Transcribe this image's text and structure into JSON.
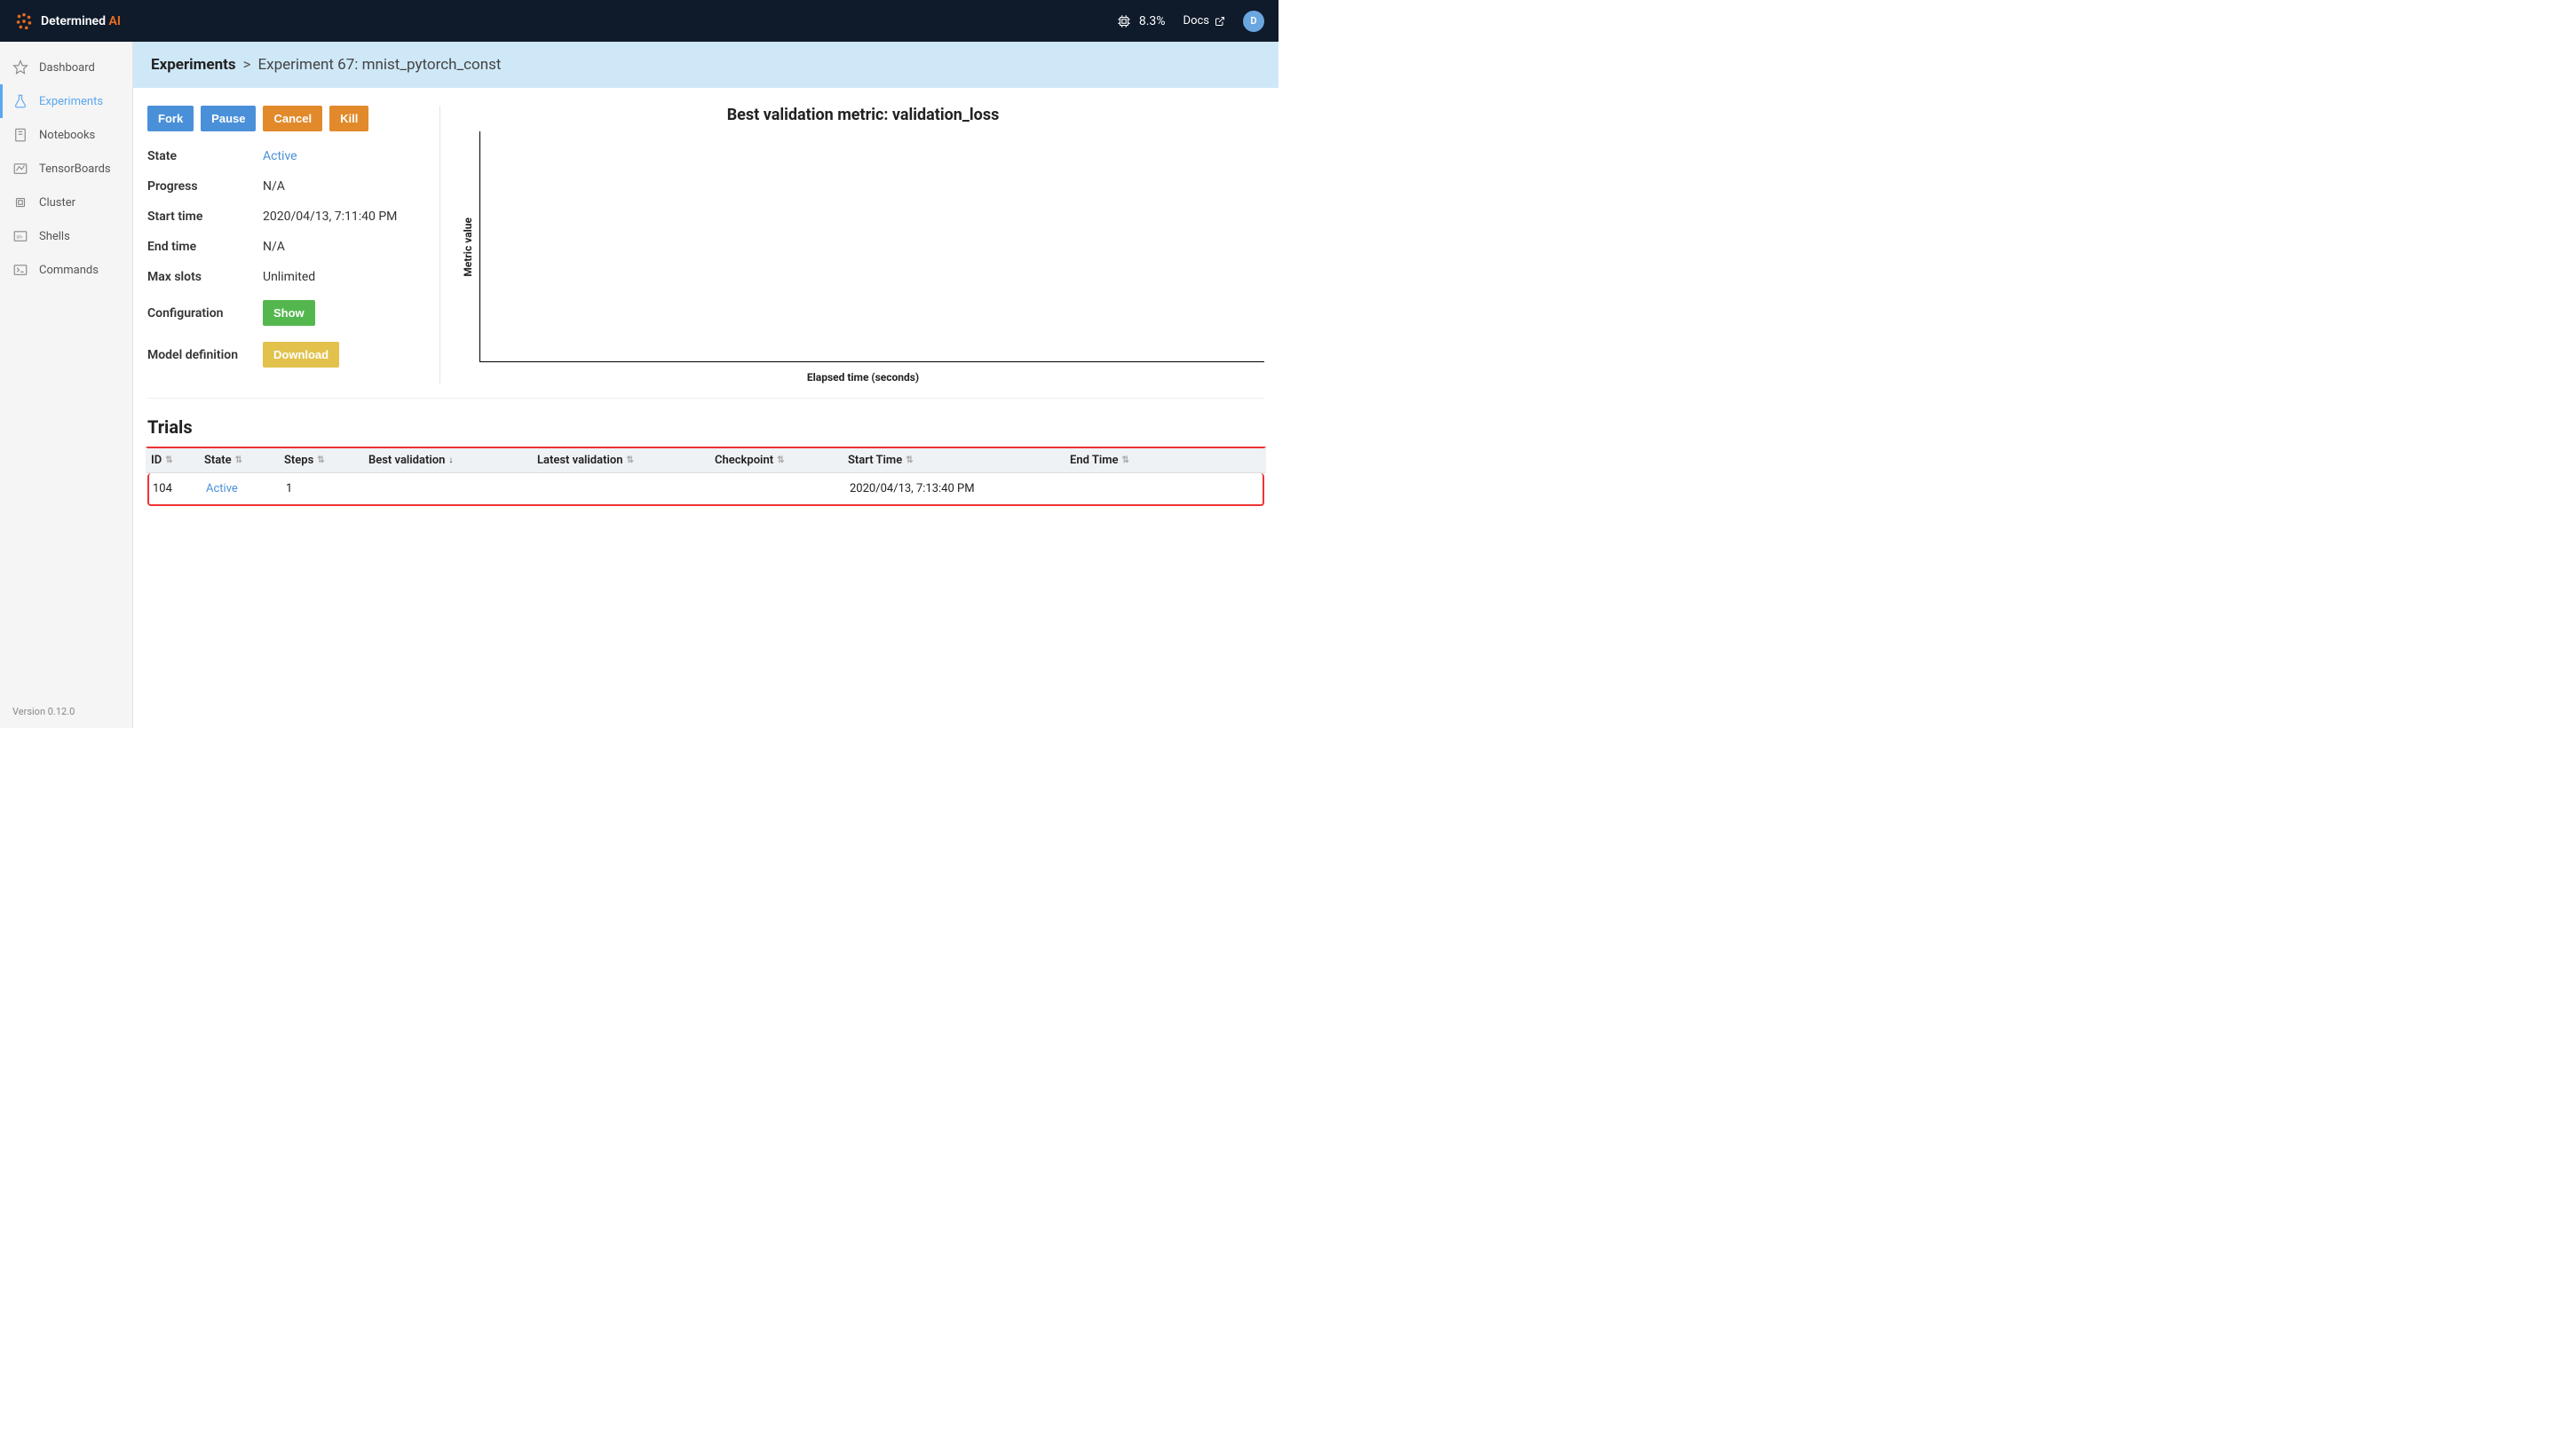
{
  "brand": {
    "name": "Determined",
    "suffix": "AI"
  },
  "topbar": {
    "cpu_percent": "8.3%",
    "docs_label": "Docs",
    "avatar_initial": "D"
  },
  "sidebar": {
    "items": [
      {
        "label": "Dashboard"
      },
      {
        "label": "Experiments"
      },
      {
        "label": "Notebooks"
      },
      {
        "label": "TensorBoards"
      },
      {
        "label": "Cluster"
      },
      {
        "label": "Shells"
      },
      {
        "label": "Commands"
      }
    ],
    "version": "Version 0.12.0"
  },
  "breadcrumb": {
    "root": "Experiments",
    "sep": ">",
    "leaf": "Experiment 67: mnist_pytorch_const"
  },
  "actions": {
    "fork": "Fork",
    "pause": "Pause",
    "cancel": "Cancel",
    "kill": "Kill"
  },
  "info": {
    "state_k": "State",
    "state_v": "Active",
    "progress_k": "Progress",
    "progress_v": "N/A",
    "start_k": "Start time",
    "start_v": "2020/04/13, 7:11:40 PM",
    "end_k": "End time",
    "end_v": "N/A",
    "slots_k": "Max slots",
    "slots_v": "Unlimited",
    "config_k": "Configuration",
    "config_btn": "Show",
    "model_k": "Model definition",
    "model_btn": "Download"
  },
  "chart": {
    "title": "Best validation metric: validation_loss",
    "ylabel": "Metric value",
    "xlabel": "Elapsed time (seconds)"
  },
  "chart_data": {
    "type": "line",
    "title": "Best validation metric: validation_loss",
    "xlabel": "Elapsed time (seconds)",
    "ylabel": "Metric value",
    "series": [],
    "x": [],
    "values": []
  },
  "trials": {
    "heading": "Trials",
    "columns": {
      "id": "ID",
      "state": "State",
      "steps": "Steps",
      "best_val": "Best validation",
      "latest_val": "Latest validation",
      "checkpoint": "Checkpoint",
      "start": "Start Time",
      "end": "End Time"
    },
    "rows": [
      {
        "id": "104",
        "state": "Active",
        "steps": "1",
        "best_val": "",
        "latest_val": "",
        "checkpoint": "",
        "start": "2020/04/13, 7:13:40 PM",
        "end": ""
      }
    ]
  }
}
